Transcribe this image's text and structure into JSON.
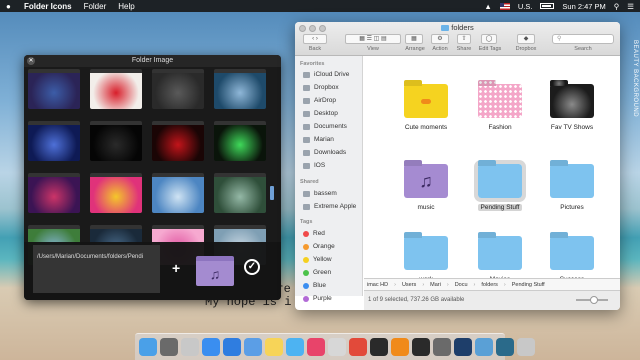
{
  "menubar": {
    "app_name": "Folder Icons",
    "menus": [
      "Folder",
      "Help"
    ],
    "language": "U.S.",
    "clock": "Sun 2:47 PM"
  },
  "desktop": {
    "text_line1": "Lore",
    "text_line2": "My hope is i",
    "watermark": "BEAUTY BACKGROUND"
  },
  "folder_image_panel": {
    "title": "Folder Image",
    "path": "/Users/Marian/Documents/folders/Pendi",
    "plus": "+",
    "thumbs": [
      {
        "color": "#2b2457",
        "accent": "#3c5da8"
      },
      {
        "color": "#f2eeea",
        "accent": "#d81e2a"
      },
      {
        "color": "#2a2a2a",
        "accent": "#5a5a5a"
      },
      {
        "color": "#1e4a6a",
        "accent": "#8fb7d8"
      },
      {
        "color": "#0e1a55",
        "accent": "#4e70d8"
      },
      {
        "color": "#050505",
        "accent": "#2a2a2a"
      },
      {
        "color": "#1a0505",
        "accent": "#c2141a"
      },
      {
        "color": "#0a140a",
        "accent": "#3fd95a"
      },
      {
        "color": "#3b1454",
        "accent": "#cc3468"
      },
      {
        "color": "#e0327a",
        "accent": "#f4c72a"
      },
      {
        "color": "#4d86c2",
        "accent": "#cfe3f3"
      },
      {
        "color": "#2f4f3a",
        "accent": "#94b8a6"
      },
      {
        "color": "#3e7d3a",
        "accent": "#86b6d6"
      },
      {
        "color": "#1a2a3a",
        "accent": "#496b8a"
      },
      {
        "color": "#f6a9d0",
        "accent": "#e055a0"
      },
      {
        "color": "#7f9fb4",
        "accent": "#cad9e4"
      }
    ]
  },
  "finder": {
    "title": "folders",
    "toolbar": {
      "back": "Back",
      "view": "View",
      "arrange": "Arrange",
      "action": "Action",
      "share": "Share",
      "edit_tags": "Edit Tags",
      "dropbox": "Dropbox",
      "search": "Search"
    },
    "sidebar": {
      "favorites_heading": "Favorites",
      "favorites": [
        "iCloud Drive",
        "Dropbox",
        "AirDrop",
        "Desktop",
        "Documents",
        "Marian",
        "Downloads",
        "IOS"
      ],
      "shared_heading": "Shared",
      "shared": [
        "bassem",
        "Extreme Apple"
      ],
      "tags_heading": "Tags",
      "tags": [
        {
          "label": "Red",
          "color": "#f04a4a"
        },
        {
          "label": "Orange",
          "color": "#f59a2e"
        },
        {
          "label": "Yellow",
          "color": "#f5d020"
        },
        {
          "label": "Green",
          "color": "#4cc24a"
        },
        {
          "label": "Blue",
          "color": "#3b8ef0"
        },
        {
          "label": "Purple",
          "color": "#b26ad6"
        }
      ]
    },
    "items": [
      {
        "label": "Cute moments",
        "color": "#f5d320",
        "art": "chick"
      },
      {
        "label": "Fashion",
        "color": "#f4a6c8",
        "art": "polka"
      },
      {
        "label": "Fav TV Shows",
        "color": "#1c1c1c",
        "art": "tv"
      },
      {
        "label": "music",
        "color": "#a58bd1",
        "art": "♫"
      },
      {
        "label": "Pending Stuff",
        "color": "#7ec3ef",
        "art": ""
      },
      {
        "label": "Pictures",
        "color": "#7ec3ef",
        "art": ""
      },
      {
        "label": "work",
        "color": "#7ec3ef",
        "art": ""
      },
      {
        "label": "Movies",
        "color": "#7ec3ef",
        "art": ""
      },
      {
        "label": "Success",
        "color": "#7ec3ef",
        "art": ""
      }
    ],
    "pathbar": [
      "imac HD",
      "Users",
      "Mari",
      "Docu",
      "folders",
      "Pending Stuff"
    ],
    "status": "1 of 9 selected, 737.26 GB available"
  },
  "dock": {
    "icons": [
      {
        "name": "finder-icon",
        "color": "#4aa0e8"
      },
      {
        "name": "activity-icon",
        "color": "#6a6a6a"
      },
      {
        "name": "launchpad-icon",
        "color": "#c8c8c8"
      },
      {
        "name": "app-store-icon",
        "color": "#3a8ef0"
      },
      {
        "name": "safari-icon",
        "color": "#2f7de0"
      },
      {
        "name": "mail-icon",
        "color": "#5b9ee6"
      },
      {
        "name": "notes-icon",
        "color": "#f7d458"
      },
      {
        "name": "finder-alt-icon",
        "color": "#4db3f2"
      },
      {
        "name": "itunes-icon",
        "color": "#e8446a"
      },
      {
        "name": "preview-icon",
        "color": "#d7d7d7"
      },
      {
        "name": "chrome-icon",
        "color": "#e24a3a"
      },
      {
        "name": "terminal-icon",
        "color": "#2a2a2a"
      },
      {
        "name": "vlc-icon",
        "color": "#f08a1a"
      },
      {
        "name": "app-icon-1",
        "color": "#2a2a2a"
      },
      {
        "name": "app-icon-2",
        "color": "#6a6a6a"
      },
      {
        "name": "photoshop-icon",
        "color": "#1e3e6a"
      },
      {
        "name": "app-icon-3",
        "color": "#5aa0d6"
      },
      {
        "name": "app-icon-4",
        "color": "#2a6a8a"
      },
      {
        "name": "trash-icon",
        "color": "#c8c8c8"
      }
    ]
  }
}
